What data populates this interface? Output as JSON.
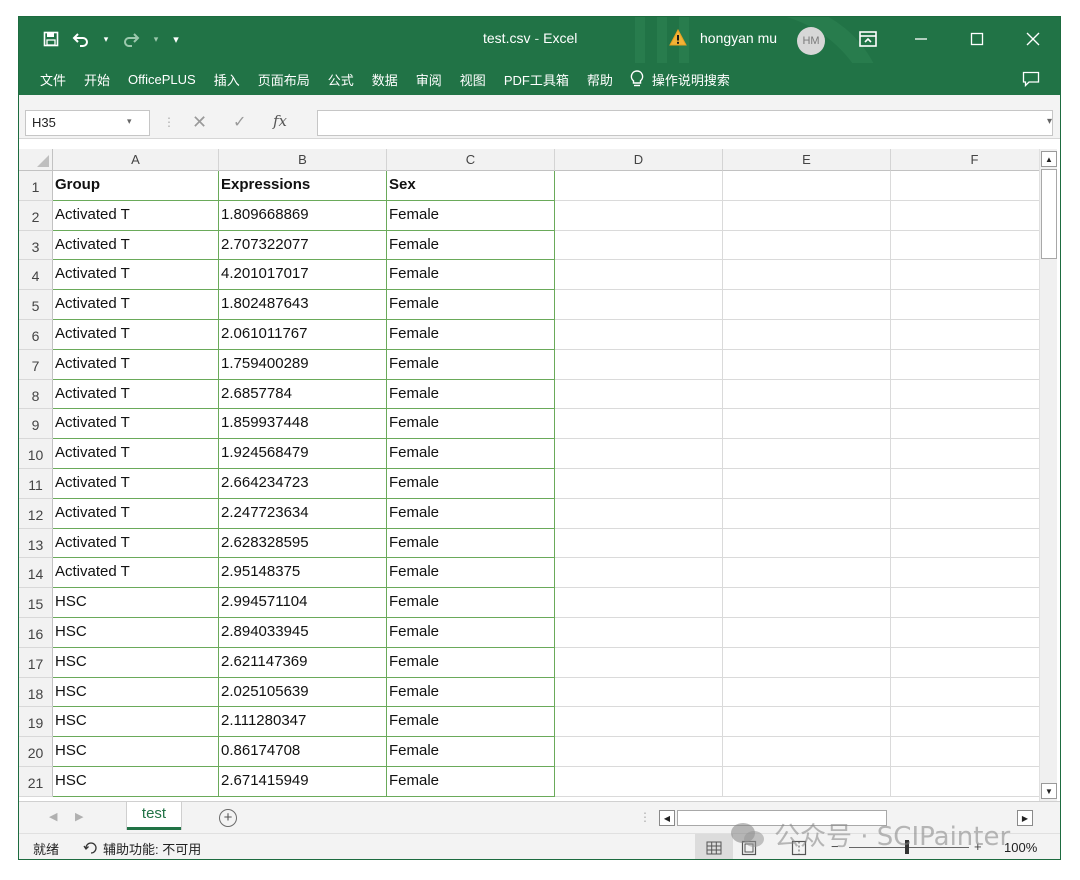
{
  "titlebar": {
    "file_name": "test.csv",
    "separator": "-",
    "app_name": "Excel",
    "user_name": "hongyan mu",
    "avatar_initials": "HM",
    "accent_color": "#217346"
  },
  "menu": {
    "items": [
      "文件",
      "开始",
      "OfficePLUS",
      "插入",
      "页面布局",
      "公式",
      "数据",
      "审阅",
      "视图",
      "PDF工具箱",
      "帮助"
    ],
    "search_label": "操作说明搜索"
  },
  "formula_bar": {
    "name_box": "H35",
    "fx_label": "fx",
    "formula": ""
  },
  "grid": {
    "columns": [
      "A",
      "B",
      "C",
      "D",
      "E",
      "F"
    ],
    "row_numbers": [
      "1",
      "2",
      "3",
      "4",
      "5",
      "6",
      "7",
      "8",
      "9",
      "10",
      "11",
      "12",
      "13",
      "14",
      "15",
      "16",
      "17",
      "18",
      "19",
      "20",
      "21"
    ],
    "rows": [
      [
        "Group",
        "Expressions",
        "Sex"
      ],
      [
        "Activated T",
        "1.809668869",
        "Female"
      ],
      [
        "Activated T",
        "2.707322077",
        "Female"
      ],
      [
        "Activated T",
        "4.201017017",
        "Female"
      ],
      [
        "Activated T",
        "1.802487643",
        "Female"
      ],
      [
        "Activated T",
        "2.061011767",
        "Female"
      ],
      [
        "Activated T",
        "1.759400289",
        "Female"
      ],
      [
        "Activated T",
        "2.6857784",
        "Female"
      ],
      [
        "Activated T",
        "1.859937448",
        "Female"
      ],
      [
        "Activated T",
        "1.924568479",
        "Female"
      ],
      [
        "Activated T",
        "2.664234723",
        "Female"
      ],
      [
        "Activated T",
        "2.247723634",
        "Female"
      ],
      [
        "Activated T",
        "2.628328595",
        "Female"
      ],
      [
        "Activated T",
        "2.95148375",
        "Female"
      ],
      [
        "HSC",
        "2.994571104",
        "Female"
      ],
      [
        "HSC",
        "2.894033945",
        "Female"
      ],
      [
        "HSC",
        "2.621147369",
        "Female"
      ],
      [
        "HSC",
        "2.025105639",
        "Female"
      ],
      [
        "HSC",
        "2.111280347",
        "Female"
      ],
      [
        "HSC",
        "0.86174708",
        "Female"
      ],
      [
        "HSC",
        "2.671415949",
        "Female"
      ]
    ]
  },
  "sheet_tabs": {
    "active": "test",
    "add_label": "+"
  },
  "status": {
    "ready": "就绪",
    "accessibility": "辅助功能: 不可用",
    "zoom": "100%"
  },
  "watermark": {
    "text": "公众号 · SCIPainter"
  }
}
